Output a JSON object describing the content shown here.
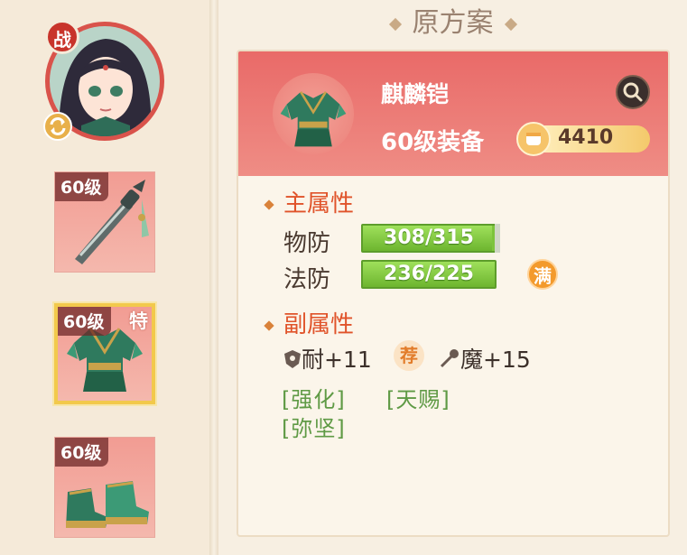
{
  "hero": {
    "battle_badge": "战"
  },
  "slots": [
    {
      "level": "60级",
      "tag": "",
      "icon": "sword"
    },
    {
      "level": "60级",
      "tag": "特",
      "icon": "armor"
    },
    {
      "level": "60级",
      "tag": "",
      "icon": "boots"
    }
  ],
  "panel": {
    "title": "原方案",
    "equipment": {
      "name": "麒麟铠",
      "level": "60级装备",
      "power": "4410"
    },
    "main_attr": {
      "title": "主属性",
      "stats": [
        {
          "label": "物防",
          "value": "308/315",
          "fill": 0.978
        },
        {
          "label": "法防",
          "value": "236/225",
          "fill": 1.0,
          "badge": "满"
        }
      ]
    },
    "sub_attr": {
      "title": "副属性",
      "stats": [
        {
          "icon": "shield-icon",
          "text": "耐+11",
          "badge": "荐"
        },
        {
          "icon": "wand-icon",
          "text": "魔+15"
        }
      ],
      "tags": [
        "[强化]",
        "[天赐]",
        "[弥坚]"
      ]
    }
  },
  "colors": {
    "header_red": "#e96a68",
    "bar_green": "#7dc43c",
    "title_orange": "#e0532a",
    "tag_green": "#5f9a45"
  }
}
